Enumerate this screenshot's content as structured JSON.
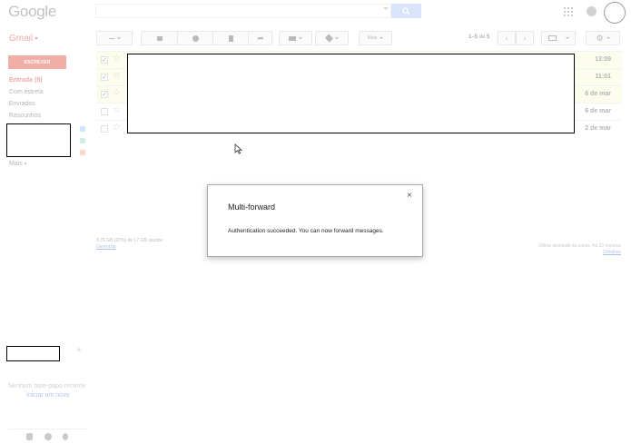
{
  "header": {
    "logo_text": "Google",
    "search": {
      "placeholder": "",
      "value": ""
    }
  },
  "app_label": "Gmail",
  "toolbar": {
    "more_label": "Mais",
    "pager": {
      "range": "1–5",
      "of": "de",
      "total": "5"
    }
  },
  "sidebar": {
    "compose_label": "ESCREVER",
    "items": [
      {
        "label": "Entrada (5)"
      },
      {
        "label": "Com estrela"
      },
      {
        "label": "Enviados"
      },
      {
        "label": "Rascunhos"
      }
    ],
    "more_label": "Mais",
    "label_colors": [
      "#9fc0ff",
      "#8fd8c4",
      "#f7a98b"
    ]
  },
  "chat": {
    "none_text": "Nenhum bate-papo recente",
    "start_text": "Iniciar um novo"
  },
  "messages": [
    {
      "time": "13:09",
      "checked": true,
      "unread": true
    },
    {
      "time": "11:01",
      "checked": true,
      "unread": true
    },
    {
      "time": "6 de mar",
      "checked": true,
      "unread": true
    },
    {
      "time": "6 de mar",
      "checked": false,
      "unread": false
    },
    {
      "time": "2 de mar",
      "checked": false,
      "unread": false
    }
  ],
  "footer": {
    "storage": "3,76 GB (22%) de 17 GB usados",
    "manage": "Gerenciar",
    "activity": "Última atividade da conta: Há 29 minutos",
    "details": "Detalhes"
  },
  "dialog": {
    "title": "Multi-forward",
    "message": "Authentication succeeded. You can now forward messages.",
    "close_glyph": "×"
  },
  "colors": {
    "accent_red": "#dd4b39",
    "search_blue": "#a9c3f5",
    "unread_bg": "#fbfbd8"
  }
}
